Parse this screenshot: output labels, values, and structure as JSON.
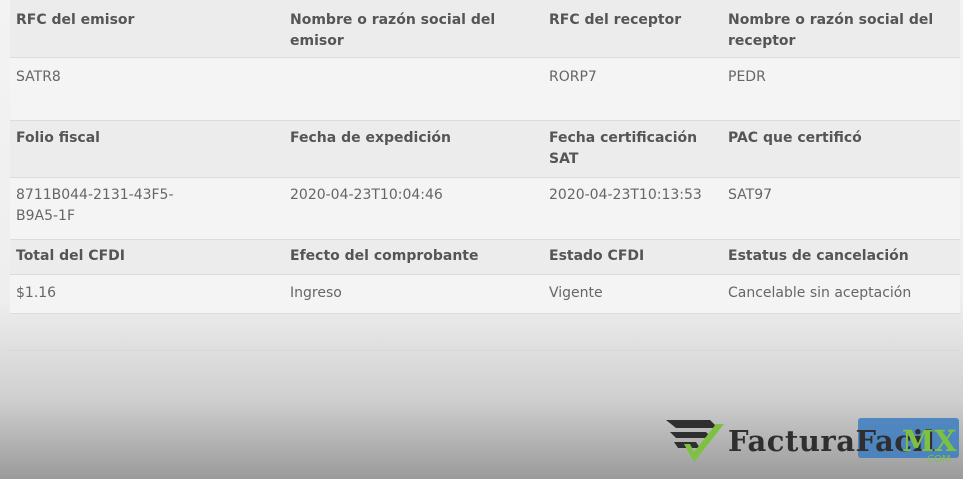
{
  "table": {
    "row1": {
      "rfc_emisor": "RFC del emisor",
      "nombre_emisor": "Nombre o razón social del emisor",
      "rfc_receptor": "RFC del receptor",
      "nombre_receptor": "Nombre o razón social del receptor"
    },
    "row2": {
      "rfc_emisor": "SATR8",
      "nombre_emisor": "",
      "rfc_receptor": "RORP7",
      "nombre_receptor": "PEDR"
    },
    "row3": {
      "folio_fiscal": "Folio fiscal",
      "fecha_expedicion": "Fecha de expedición",
      "fecha_certificacion": "Fecha certificación SAT",
      "pac": "PAC que certificó"
    },
    "row4": {
      "folio_fiscal": "8711B044-2131-43F5-B9A5-1F",
      "fecha_expedicion": "2020-04-23T10:04:46",
      "fecha_certificacion": "2020-04-23T10:13:53",
      "pac": "SAT97"
    },
    "row5": {
      "total": "Total del CFDI",
      "efecto": "Efecto del comprobante",
      "estado": "Estado CFDI",
      "estatus_cancelacion": "Estatus de cancelación"
    },
    "row6": {
      "total": "$1.16",
      "efecto": "Ingreso",
      "estado": "Vigente",
      "estatus_cancelacion": "Cancelable sin aceptación"
    }
  },
  "watermark": {
    "brand": "FacturaFacil",
    "brand_suffix": "MX",
    "domain": ".COM"
  },
  "colors": {
    "brand_green": "#7cc142",
    "button_blue": "#3d7cc0"
  }
}
